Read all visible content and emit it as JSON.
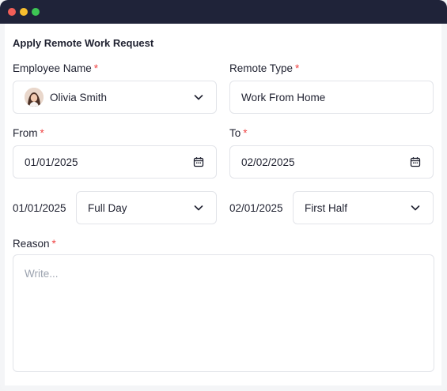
{
  "window": {
    "controls": [
      "close",
      "minimize",
      "maximize"
    ]
  },
  "form": {
    "title": "Apply Remote Work Request",
    "required_marker": "*",
    "employee": {
      "label": "Employee Name",
      "value": "Olivia Smith"
    },
    "remote_type": {
      "label": "Remote Type",
      "value": "Work From Home"
    },
    "from": {
      "label": "From",
      "value": "01/01/2025"
    },
    "to": {
      "label": "To",
      "value": "02/02/2025"
    },
    "from_session": {
      "date": "01/01/2025",
      "value": "Full Day"
    },
    "to_session": {
      "date": "02/01/2025",
      "value": "First Half"
    },
    "reason": {
      "label": "Reason",
      "placeholder": "Write..."
    }
  },
  "colors": {
    "titlebar": "#1f2339",
    "required": "#ef4444",
    "border": "#e2e4e9",
    "placeholder": "#9ca3af"
  },
  "icons": {
    "dropdown": "chevron-down-icon",
    "date": "calendar-icon"
  }
}
